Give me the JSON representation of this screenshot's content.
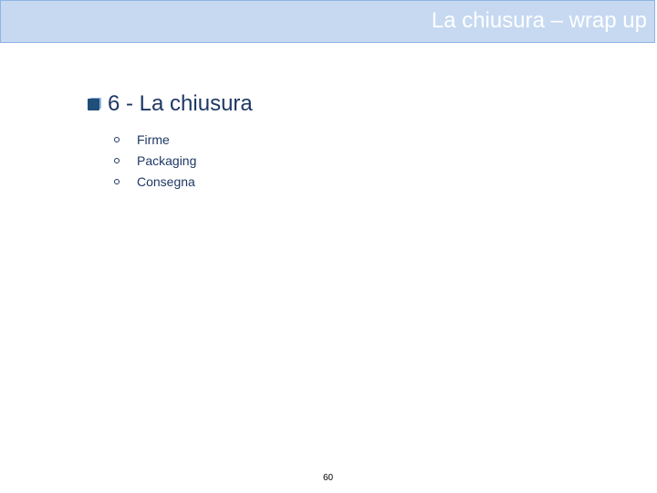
{
  "slide": {
    "title": "La chiusura – wrap up",
    "section": {
      "number": "6",
      "label": "6 - La chiusura",
      "items": [
        "Firme",
        "Packaging",
        "Consegna"
      ]
    },
    "page_number": "60"
  },
  "colors": {
    "title_bar": "#c6d9f1",
    "title_text": "#ffffff",
    "body_text": "#1f3864",
    "bullet": "#1f4e79"
  },
  "icons": {
    "section_bullet": "square-bullet-icon",
    "item_bullet": "hollow-circle-bullet-icon"
  }
}
